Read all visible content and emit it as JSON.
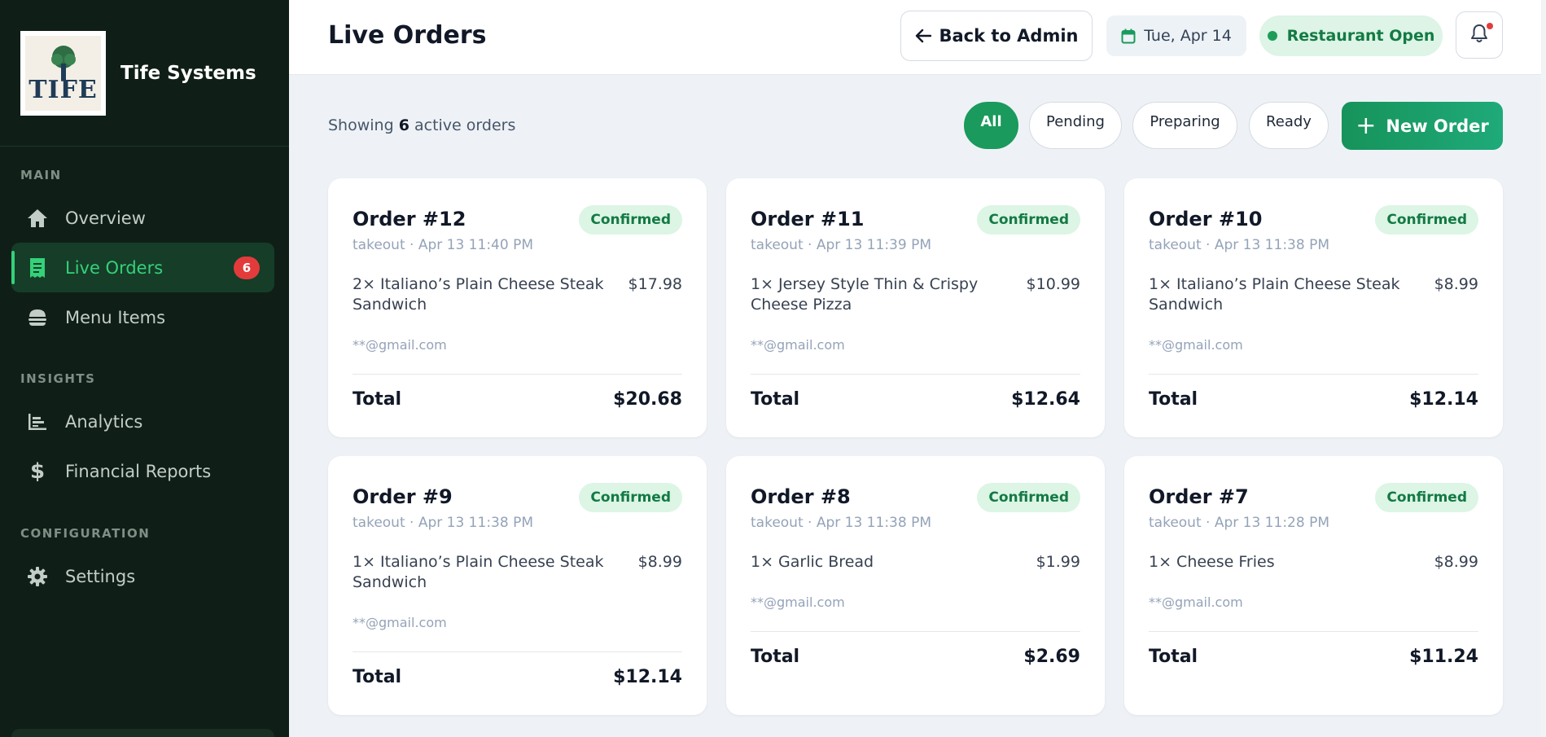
{
  "brand": {
    "name": "Tife Systems",
    "logo_text": "TIFE"
  },
  "sidebar": {
    "sections": [
      {
        "label": "MAIN"
      },
      {
        "label": "INSIGHTS"
      },
      {
        "label": "CONFIGURATION"
      }
    ],
    "items": [
      {
        "label": "Overview",
        "icon": "home-icon"
      },
      {
        "label": "Live Orders",
        "icon": "receipt-icon",
        "badge": "6",
        "active": true
      },
      {
        "label": "Menu Items",
        "icon": "burger-icon"
      },
      {
        "label": "Analytics",
        "icon": "bar-chart-icon"
      },
      {
        "label": "Financial Reports",
        "icon": "dollar-icon"
      },
      {
        "label": "Settings",
        "icon": "gear-icon"
      }
    ]
  },
  "header": {
    "title": "Live Orders",
    "back_label": "Back to Admin",
    "date": "Tue, Apr 14",
    "status": "Restaurant Open"
  },
  "toolbar": {
    "showing_prefix": "Showing",
    "count": "6",
    "showing_suffix": "active orders",
    "filters": [
      "All",
      "Pending",
      "Preparing",
      "Ready"
    ],
    "active_filter": "All",
    "new_order_label": "New Order"
  },
  "orders": [
    {
      "title": "Order #12",
      "meta": "takeout · Apr 13 11:40 PM",
      "status": "Confirmed",
      "item": "2× Italiano’s Plain Cheese Steak Sandwich",
      "price": "$17.98",
      "email": "**@gmail.com",
      "total_label": "Total",
      "total": "$20.68"
    },
    {
      "title": "Order #11",
      "meta": "takeout · Apr 13 11:39 PM",
      "status": "Confirmed",
      "item": "1× Jersey Style Thin & Crispy Cheese Pizza",
      "price": "$10.99",
      "email": "**@gmail.com",
      "total_label": "Total",
      "total": "$12.64"
    },
    {
      "title": "Order #10",
      "meta": "takeout · Apr 13 11:38 PM",
      "status": "Confirmed",
      "item": "1× Italiano’s Plain Cheese Steak Sandwich",
      "price": "$8.99",
      "email": "**@gmail.com",
      "total_label": "Total",
      "total": "$12.14"
    },
    {
      "title": "Order #9",
      "meta": "takeout · Apr 13 11:38 PM",
      "status": "Confirmed",
      "item": "1× Italiano’s Plain Cheese Steak Sandwich",
      "price": "$8.99",
      "email": "**@gmail.com",
      "total_label": "Total",
      "total": "$12.14"
    },
    {
      "title": "Order #8",
      "meta": "takeout · Apr 13 11:38 PM",
      "status": "Confirmed",
      "item": "1× Garlic Bread",
      "price": "$1.99",
      "email": "**@gmail.com",
      "total_label": "Total",
      "total": "$2.69"
    },
    {
      "title": "Order #7",
      "meta": "takeout · Apr 13 11:28 PM",
      "status": "Confirmed",
      "item": "1× Cheese Fries",
      "price": "$8.99",
      "email": "**@gmail.com",
      "total_label": "Total",
      "total": "$11.24"
    }
  ],
  "colors": {
    "sidebar_bg": "#0f1f17",
    "accent": "#1a9a5c",
    "active_text": "#34d179",
    "badge": "#e33b3b",
    "status_bg": "#dcf5e5",
    "status_text": "#137a44"
  }
}
